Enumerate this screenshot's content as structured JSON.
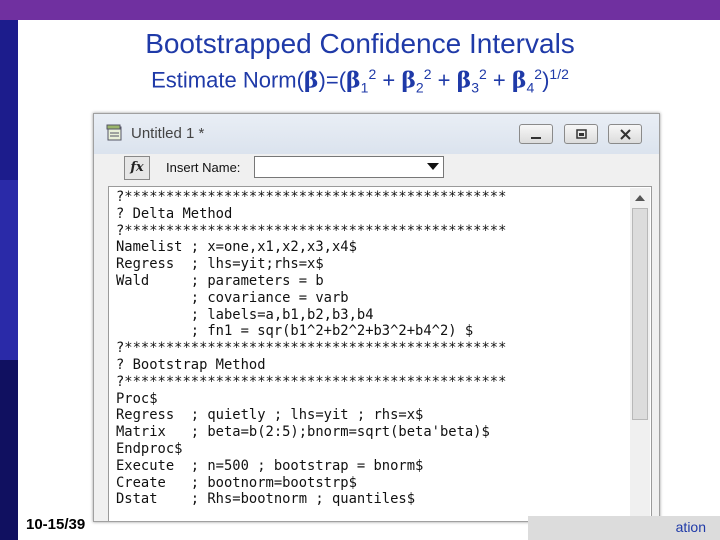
{
  "slide": {
    "title": "Bootstrapped Confidence Intervals",
    "subtitle": {
      "prefix": "Estimate Norm(",
      "beta": "β",
      "mid": ")=(",
      "terms": [
        {
          "beta": "β",
          "sub": "1",
          "sup": "2"
        },
        {
          "beta": "β",
          "sub": "2",
          "sup": "2"
        },
        {
          "beta": "β",
          "sub": "3",
          "sup": "2"
        },
        {
          "beta": "β",
          "sub": "4",
          "sup": "2"
        }
      ],
      "plus": " + ",
      "close": ")",
      "power": "1/2"
    },
    "slide_number": "10-15/39",
    "footer": "ation"
  },
  "window": {
    "title": "Untitled 1 *",
    "toolbar": {
      "fx_label": "fx",
      "insert_label": "Insert Name:",
      "insert_value": ""
    },
    "code_lines": [
      "?**********************************************",
      "? Delta Method",
      "?**********************************************",
      "Namelist ; x=one,x1,x2,x3,x4$",
      "Regress  ; lhs=yit;rhs=x$",
      "Wald     ; parameters = b",
      "         ; covariance = varb",
      "         ; labels=a,b1,b2,b3,b4",
      "         ; fn1 = sqr(b1^2+b2^2+b3^2+b4^2) $",
      "?**********************************************",
      "? Bootstrap Method",
      "?**********************************************",
      "Proc$",
      "Regress  ; quietly ; lhs=yit ; rhs=x$",
      "Matrix   ; beta=b(2:5);bnorm=sqrt(beta'beta)$",
      "Endproc$",
      "Execute  ; n=500 ; bootstrap = bnorm$",
      "Create   ; bootnorm=bootstrp$",
      "Dstat    ; Rhs=bootnorm ; quantiles$"
    ]
  }
}
